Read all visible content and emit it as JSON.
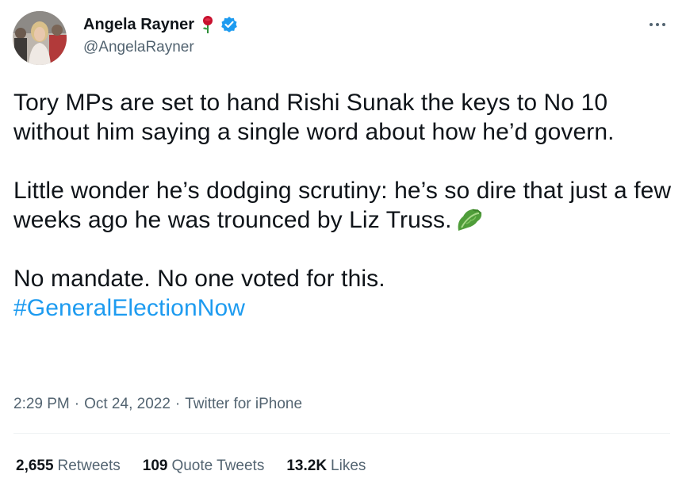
{
  "author": {
    "display_name": "Angela Rayner",
    "handle": "@AngelaRayner",
    "badge_icons": [
      "rose-icon",
      "verified-icon"
    ],
    "verified_color": "#1d9bf0"
  },
  "more_icon": "more-horizontal-icon",
  "tweet": {
    "line1": "Tory MPs are set to hand Rishi Sunak the keys to No 10 without him saying a single word about how he’d govern.",
    "line2": "Little wonder he’s dodging scrutiny: he’s so dire that just a few weeks ago he was trounced by Liz Truss.",
    "line2_emoji": "lettuce-icon",
    "line3": "No mandate. No one voted for this.",
    "hashtag": "#GeneralElectionNow"
  },
  "meta": {
    "time": "2:29 PM",
    "separator": "·",
    "date": "Oct 24, 2022",
    "source": "Twitter for iPhone"
  },
  "stats": {
    "retweets_count": "2,655",
    "retweets_label": "Retweets",
    "quotes_count": "109",
    "quotes_label": "Quote Tweets",
    "likes_count": "13.2K",
    "likes_label": "Likes"
  },
  "colors": {
    "text": "#0f1419",
    "secondary": "#536471",
    "link": "#1d9bf0",
    "divider": "#eff3f4"
  }
}
